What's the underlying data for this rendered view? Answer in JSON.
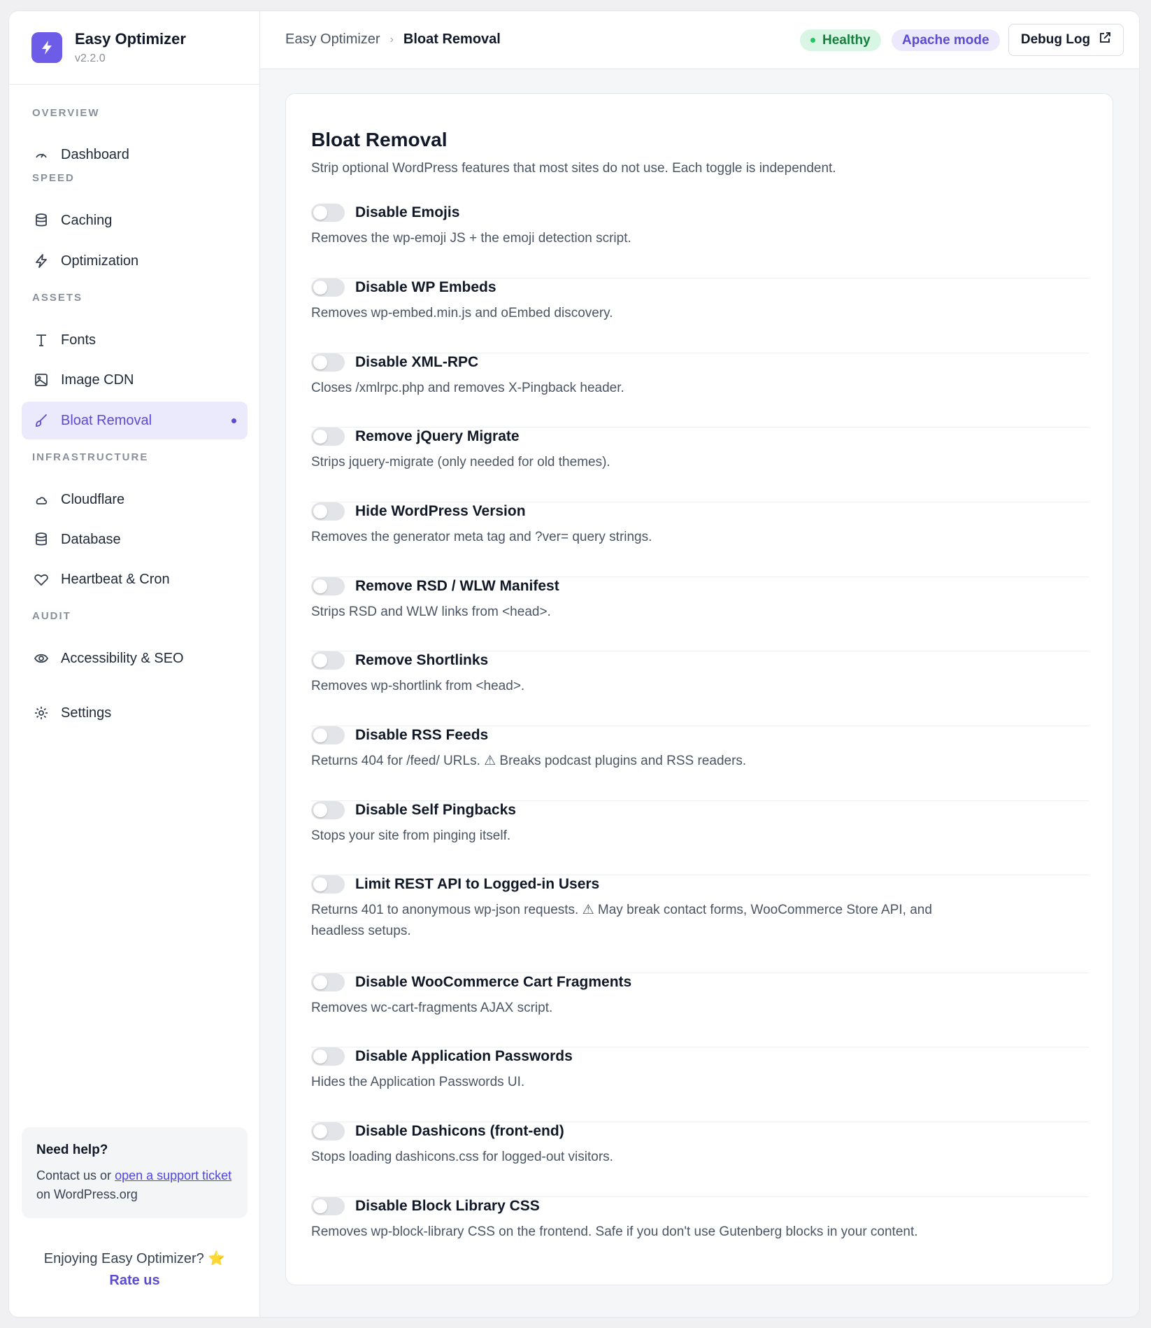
{
  "app": {
    "name": "Easy Optimizer",
    "version": "v2.2.0"
  },
  "sidebar": {
    "sections": [
      {
        "label": "OVERVIEW"
      },
      {
        "label": "SPEED"
      },
      {
        "label": "ASSETS"
      },
      {
        "label": "INFRASTRUCTURE"
      },
      {
        "label": "AUDIT"
      }
    ],
    "items": [
      {
        "label": "Dashboard",
        "icon": "gauge-icon"
      },
      {
        "label": "Caching",
        "icon": "database-icon"
      },
      {
        "label": "Optimization",
        "icon": "lightning-icon"
      },
      {
        "label": "Fonts",
        "icon": "type-icon"
      },
      {
        "label": "Image CDN",
        "icon": "image-icon"
      },
      {
        "label": "Bloat Removal",
        "icon": "broom-icon",
        "active": true
      },
      {
        "label": "Cloudflare",
        "icon": "cloud-icon"
      },
      {
        "label": "Database",
        "icon": "database-icon"
      },
      {
        "label": "Heartbeat & Cron",
        "icon": "heart-icon"
      },
      {
        "label": "Accessibility & SEO",
        "icon": "eye-icon"
      },
      {
        "label": "Settings",
        "icon": "gear-icon"
      }
    ],
    "help": {
      "title": "Need help?",
      "prefix": "Contact us or ",
      "link": "open a support ticket",
      "suffix": " on WordPress.org"
    },
    "rate": {
      "text": "Enjoying Easy Optimizer? ⭐",
      "link": "Rate us"
    }
  },
  "topbar": {
    "breadcrumb": [
      "Easy Optimizer",
      "Bloat Removal"
    ],
    "status": "Healthy",
    "mode": "Apache mode",
    "debug_label": "Debug Log"
  },
  "main": {
    "title": "Bloat Removal",
    "subtitle": "Strip optional WordPress features that most sites do not use. Each toggle is independent.",
    "options": [
      {
        "title": "Disable Emojis",
        "desc": "Removes the wp-emoji JS + the emoji detection script.",
        "enabled": false
      },
      {
        "title": "Disable WP Embeds",
        "desc": "Removes wp-embed.min.js and oEmbed discovery.",
        "enabled": false
      },
      {
        "title": "Disable XML-RPC",
        "desc": "Closes /xmlrpc.php and removes X-Pingback header.",
        "enabled": false
      },
      {
        "title": "Remove jQuery Migrate",
        "desc": "Strips jquery-migrate (only needed for old themes).",
        "enabled": false
      },
      {
        "title": "Hide WordPress Version",
        "desc": "Removes the generator meta tag and ?ver= query strings.",
        "enabled": false
      },
      {
        "title": "Remove RSD / WLW Manifest",
        "desc": "Strips RSD and WLW links from <head>.",
        "enabled": false
      },
      {
        "title": "Remove Shortlinks",
        "desc": "Removes wp-shortlink from <head>.",
        "enabled": false
      },
      {
        "title": "Disable RSS Feeds",
        "desc": "Returns 404 for /feed/ URLs. ⚠ Breaks podcast plugins and RSS readers.",
        "enabled": false
      },
      {
        "title": "Disable Self Pingbacks",
        "desc": "Stops your site from pinging itself.",
        "enabled": false
      },
      {
        "title": "Limit REST API to Logged-in Users",
        "desc": "Returns 401 to anonymous wp-json requests. ⚠ May break contact forms, WooCommerce Store API, and headless setups.",
        "enabled": false
      },
      {
        "title": "Disable WooCommerce Cart Fragments",
        "desc": "Removes wc-cart-fragments AJAX script.",
        "enabled": false
      },
      {
        "title": "Disable Application Passwords",
        "desc": "Hides the Application Passwords UI.",
        "enabled": false
      },
      {
        "title": "Disable Dashicons (front-end)",
        "desc": "Stops loading dashicons.css for logged-out visitors.",
        "enabled": false
      },
      {
        "title": "Disable Block Library CSS",
        "desc": "Removes wp-block-library CSS on the frontend. Safe if you don't use Gutenberg blocks in your content.",
        "enabled": false
      }
    ]
  },
  "colors": {
    "accent": "#6d5ce7",
    "healthy": "#15803d",
    "active_bg": "#ebe9fc"
  }
}
